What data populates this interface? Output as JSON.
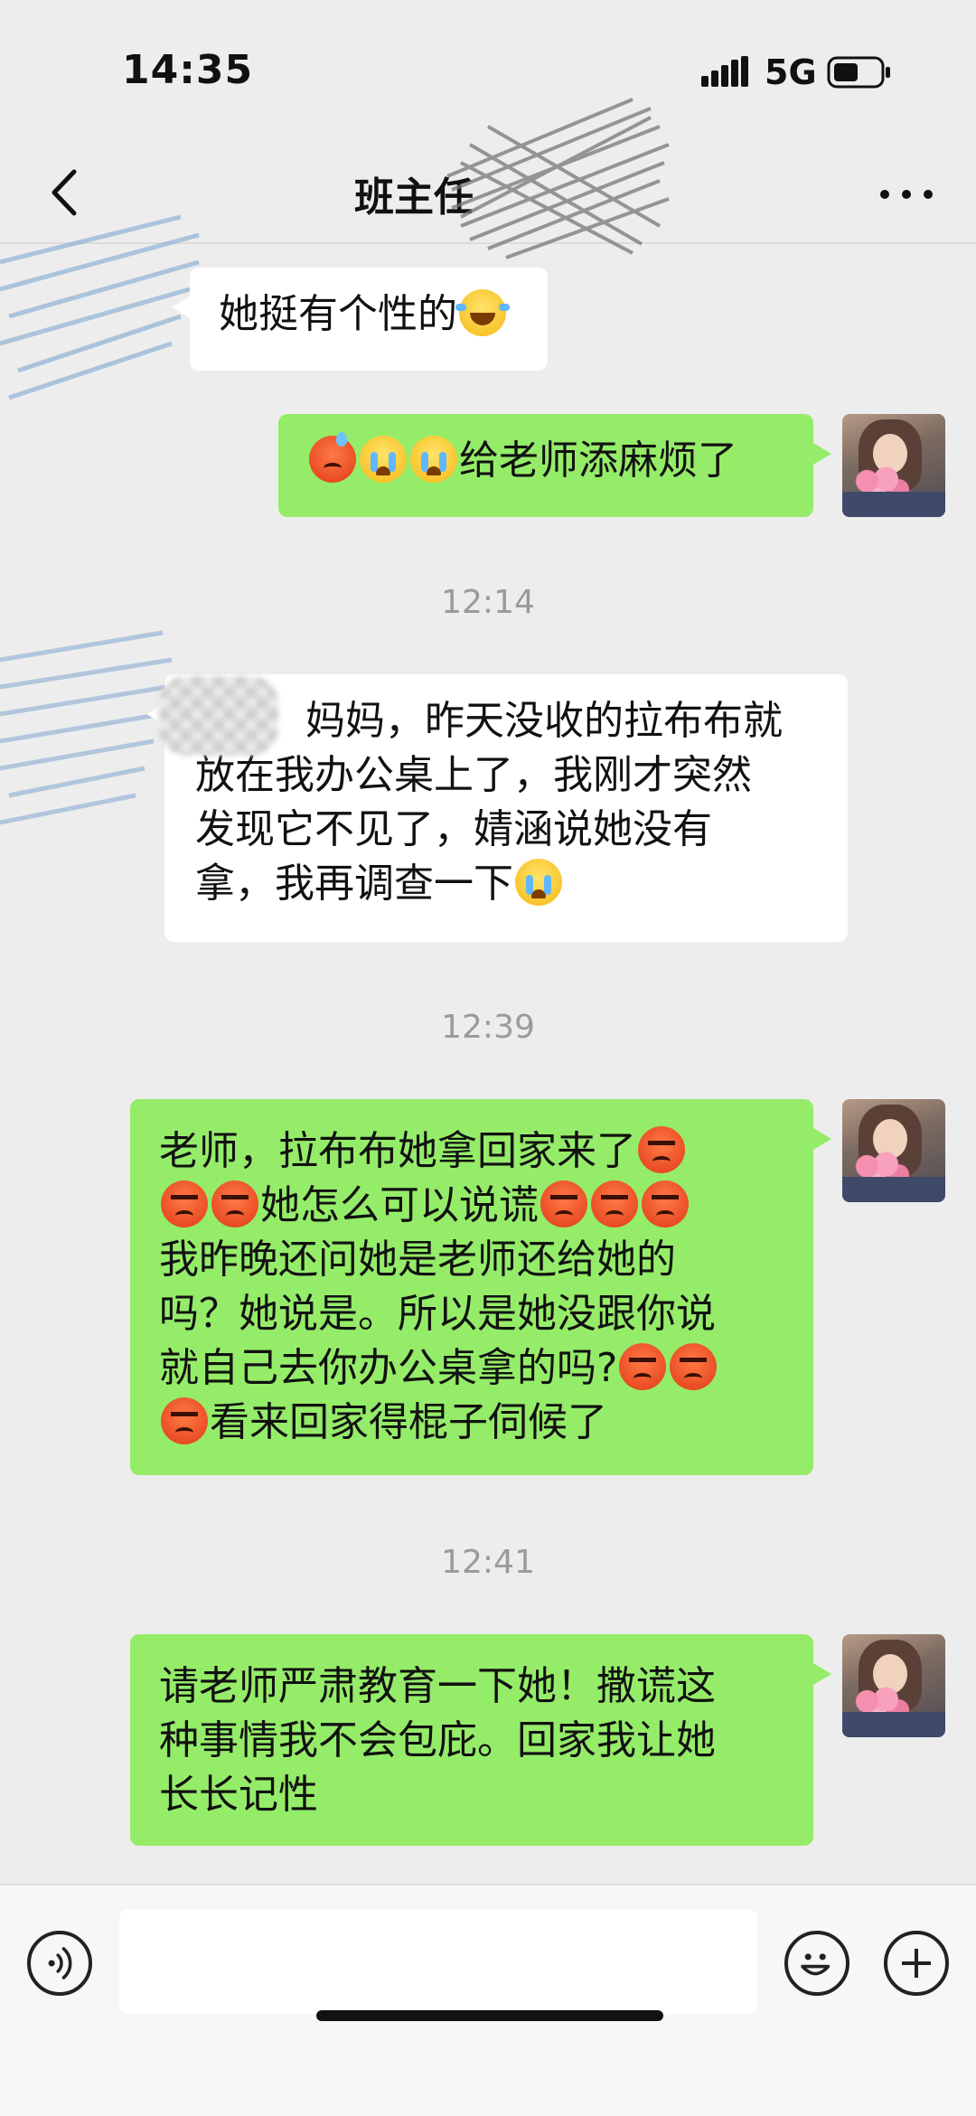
{
  "status_bar": {
    "time": "14:35",
    "network": "5G",
    "signal_icon": "signal-bars-icon",
    "battery_icon": "battery-icon"
  },
  "nav": {
    "title": "班主任",
    "back_icon": "chevron-left-icon",
    "more_icon": "more-dots-icon"
  },
  "messages": [
    {
      "side": "in",
      "text": "她挺有个性的",
      "emoji_after": [
        "laugh-cry"
      ]
    },
    {
      "side": "out",
      "emoji_before": [
        "sweat-angry",
        "cry",
        "cry"
      ],
      "text": "给老师添麻烦了"
    },
    {
      "type": "time",
      "text": "12:14"
    },
    {
      "side": "in",
      "lines": [
        "妈妈，昨天没收的拉布布就",
        "放在我办公桌上了，我刚才突然",
        "发现它不见了，婧涵说她没有",
        "拿，我再调查一下"
      ],
      "emoji_after": [
        "cry"
      ]
    },
    {
      "type": "time",
      "text": "12:39"
    },
    {
      "side": "out",
      "lines": [
        "老师，拉布布她拿回家来了",
        "她怎么可以说谎",
        "我昨晚还问她是老师还给她的",
        "吗？她说是。所以是她没跟你说",
        "就自己去你办公桌拿的吗?",
        "看来回家得棍子伺候了"
      ]
    },
    {
      "type": "time",
      "text": "12:41"
    },
    {
      "side": "out",
      "lines": [
        "请老师严肃教育一下她！撒谎这",
        "种事情我不会包庇。回家我让她",
        "长长记性"
      ]
    }
  ],
  "input_bar": {
    "placeholder": "",
    "voice_icon": "voice-icon",
    "emoji_icon": "smiley-icon",
    "plus_icon": "plus-icon"
  }
}
